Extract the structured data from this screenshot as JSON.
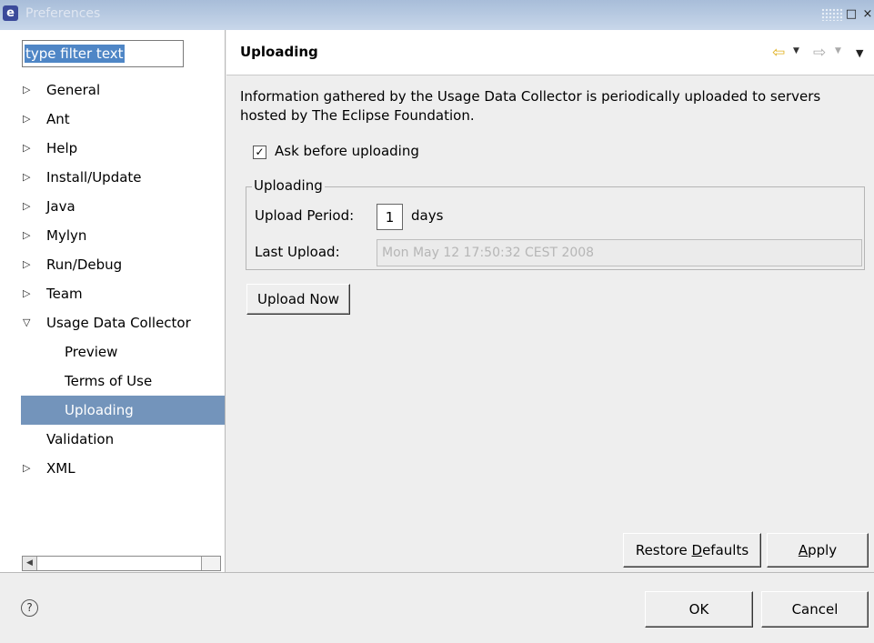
{
  "window": {
    "title": "Preferences"
  },
  "filter": {
    "value": "type filter text"
  },
  "tree": {
    "items": [
      {
        "label": "General",
        "arrow": "▷",
        "child": false
      },
      {
        "label": "Ant",
        "arrow": "▷",
        "child": false
      },
      {
        "label": "Help",
        "arrow": "▷",
        "child": false
      },
      {
        "label": "Install/Update",
        "arrow": "▷",
        "child": false
      },
      {
        "label": "Java",
        "arrow": "▷",
        "child": false
      },
      {
        "label": "Mylyn",
        "arrow": "▷",
        "child": false
      },
      {
        "label": "Run/Debug",
        "arrow": "▷",
        "child": false
      },
      {
        "label": "Team",
        "arrow": "▷",
        "child": false
      },
      {
        "label": "Usage Data Collector",
        "arrow": "▽",
        "child": false
      },
      {
        "label": "Preview",
        "arrow": "",
        "child": true
      },
      {
        "label": "Terms of Use",
        "arrow": "",
        "child": true
      },
      {
        "label": "Uploading",
        "arrow": "",
        "child": true,
        "selected": true
      },
      {
        "label": "Validation",
        "arrow": "",
        "child": false
      },
      {
        "label": "XML",
        "arrow": "▷",
        "child": false
      }
    ]
  },
  "page": {
    "title": "Uploading",
    "description": "Information gathered by the Usage Data Collector is periodically uploaded to servers hosted by The Eclipse Foundation.",
    "ask_before_uploading": {
      "label": "Ask before uploading",
      "checked": true
    },
    "group": {
      "legend": "Uploading",
      "period_label": "Upload Period:",
      "period_value": "1",
      "period_unit": "days",
      "last_label": "Last Upload:",
      "last_value": "Mon May 12 17:50:32 CEST 2008"
    },
    "upload_now": "Upload Now",
    "restore_defaults": {
      "pre": "Restore ",
      "mnemonic": "D",
      "post": "efaults"
    },
    "apply": {
      "mnemonic": "A",
      "post": "pply"
    }
  },
  "dialog": {
    "ok": "OK",
    "cancel": "Cancel"
  },
  "icons": {
    "app": "eclipse-icon",
    "back": "back-arrow-icon",
    "forward": "forward-arrow-icon",
    "menu": "view-menu-icon",
    "help": "help-icon"
  },
  "colors": {
    "selection": "#7394bb",
    "filter_selection": "#4f86c6",
    "titlebar": "#a8bdd9",
    "back_arrow": "#e0b020"
  }
}
